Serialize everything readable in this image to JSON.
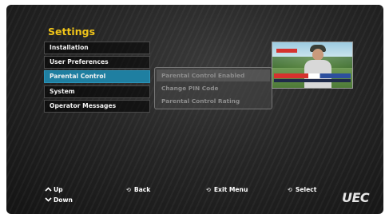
{
  "page": {
    "title": "Settings",
    "logo_text": "UEC"
  },
  "menu": {
    "items": [
      {
        "label": "Installation",
        "active": false
      },
      {
        "label": "User Preferences",
        "active": false
      },
      {
        "label": "Parental Control",
        "active": true
      },
      {
        "label": "System",
        "active": false
      },
      {
        "label": "Operator Messages",
        "active": false
      }
    ]
  },
  "submenu": {
    "items": [
      {
        "label": "Parental Control Enabled"
      },
      {
        "label": "Change PIN Code"
      },
      {
        "label": "Parental Control Rating"
      }
    ]
  },
  "preview": {
    "icon": "tv-preview-thumbnail"
  },
  "hints": {
    "up": "Up",
    "down": "Down",
    "back": "Back",
    "exit_menu": "Exit Menu",
    "select": "Select"
  },
  "colors": {
    "title": "#f0c419",
    "active_item": "#1f7fa1"
  }
}
